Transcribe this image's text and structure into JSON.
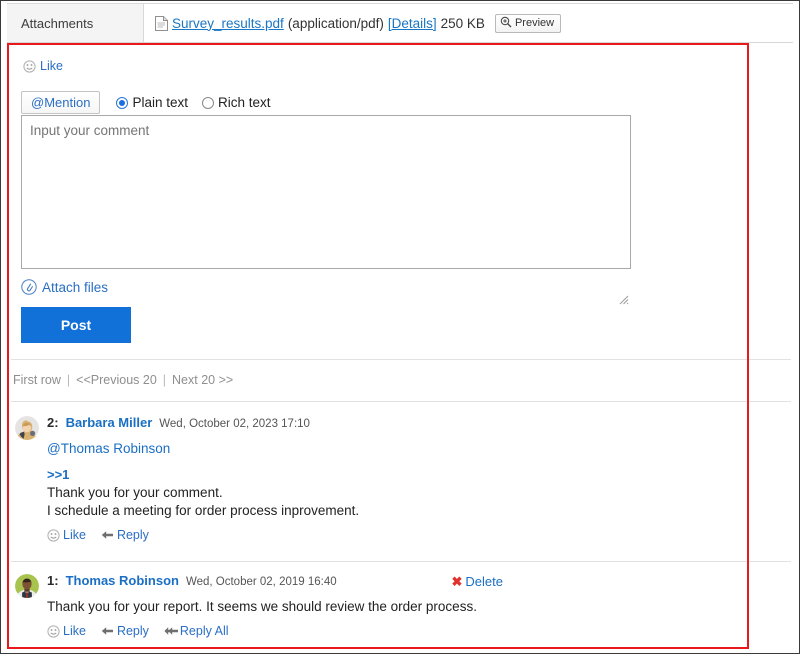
{
  "attachments": {
    "label": "Attachments",
    "file_icon": "document-icon",
    "file_name": "Survey_results.pdf",
    "mime_type": "(application/pdf)",
    "details_label": "[Details]",
    "file_size": "250 KB",
    "preview_label": "Preview",
    "preview_icon": "zoom-in-icon"
  },
  "post_form": {
    "like_label": "Like",
    "like_icon": "smiley-icon",
    "mention_label": "@Mention",
    "format_options": [
      {
        "label": "Plain text",
        "selected": true
      },
      {
        "label": "Rich text",
        "selected": false
      }
    ],
    "comment_placeholder": "Input your comment",
    "comment_value": "",
    "attach_files_label": "Attach files",
    "attach_files_icon": "paperclip-icon",
    "post_label": "Post"
  },
  "pager": {
    "first_row": "First row",
    "separator": "|",
    "previous": "<<Previous 20",
    "next": "Next 20 >>"
  },
  "comments": [
    {
      "number": "2:",
      "author": "Barbara Miller",
      "date": "Wed, October 02, 2023 17:10",
      "avatar": "avatar-barbara-miller",
      "mention": "@Thomas Robinson",
      "quote": ">>1",
      "body_lines": [
        "Thank you for your comment.",
        "I schedule a meeting for order process inprovement."
      ],
      "actions": [
        {
          "label": "Like",
          "icon": "smiley-icon"
        },
        {
          "label": "Reply",
          "icon": "reply-arrow-icon"
        }
      ],
      "delete": null
    },
    {
      "number": "1:",
      "author": "Thomas Robinson",
      "date": "Wed, October 02, 2019 16:40",
      "avatar": "avatar-thomas-robinson",
      "mention": null,
      "quote": null,
      "body_lines": [
        "Thank you for your report. It seems we should review the order process."
      ],
      "actions": [
        {
          "label": "Like",
          "icon": "smiley-icon"
        },
        {
          "label": "Reply",
          "icon": "reply-arrow-icon"
        },
        {
          "label": "Reply All",
          "icon": "reply-all-arrow-icon"
        }
      ],
      "delete": {
        "label": "Delete",
        "icon": "red-x-icon"
      }
    }
  ],
  "colors": {
    "link": "#1a6fc4",
    "highlight_border": "#e8181b",
    "post_button": "#1271d8",
    "delete_icon": "#e0332e",
    "muted_text": "#8e8e8e"
  }
}
